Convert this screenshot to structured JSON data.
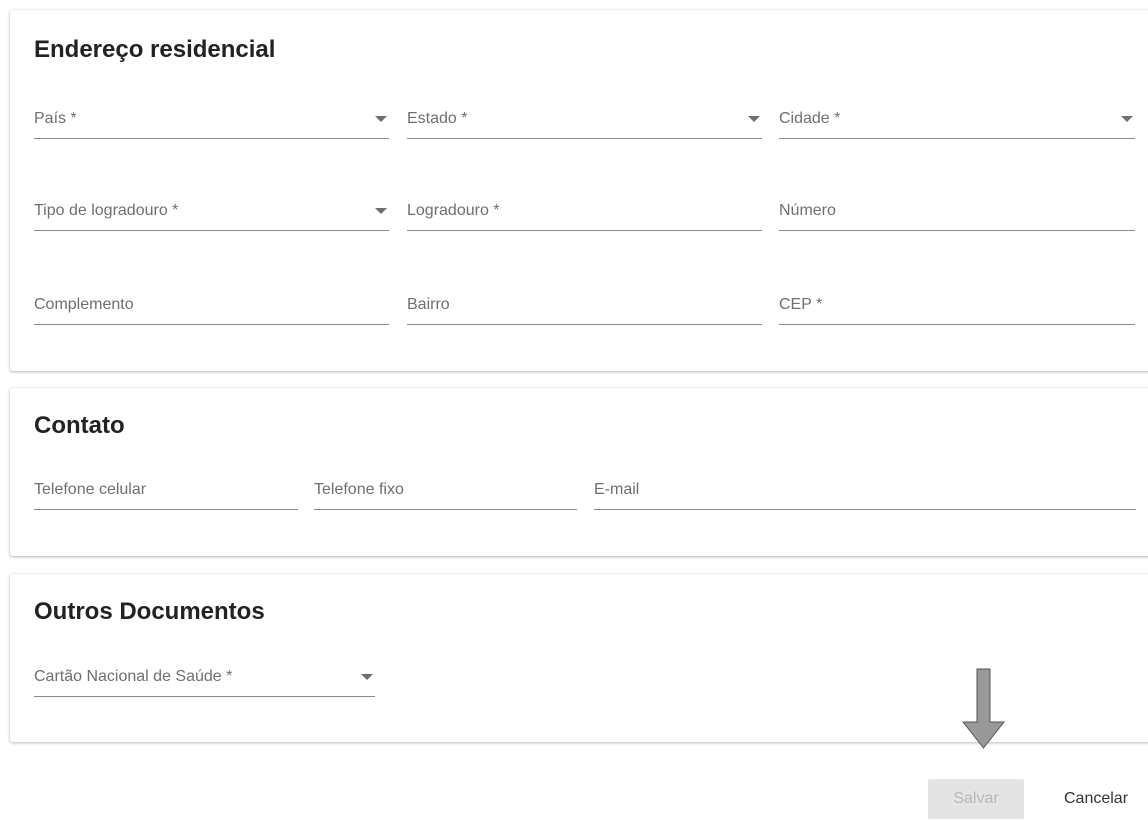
{
  "endereco": {
    "title": "Endereço residencial",
    "fields": {
      "pais": "País *",
      "estado": "Estado *",
      "cidade": "Cidade *",
      "tipo_logradouro": "Tipo de logradouro *",
      "logradouro": "Logradouro *",
      "numero": "Número",
      "complemento": "Complemento",
      "bairro": "Bairro",
      "cep": "CEP *"
    }
  },
  "contato": {
    "title": "Contato",
    "fields": {
      "telefone_celular": "Telefone celular",
      "telefone_fixo": "Telefone fixo",
      "email": "E-mail"
    }
  },
  "outros": {
    "title": "Outros Documentos",
    "fields": {
      "cartao_sus": "Cartão Nacional de Saúde *"
    }
  },
  "actions": {
    "save_label": "Salvar",
    "cancel_label": "Cancelar"
  },
  "icons": {
    "dropdown": "chevron-down-icon",
    "annotation": "down-arrow-icon"
  },
  "colors": {
    "save_disabled_bg": "#e4e4e4",
    "annotation_arrow": "#999999"
  }
}
